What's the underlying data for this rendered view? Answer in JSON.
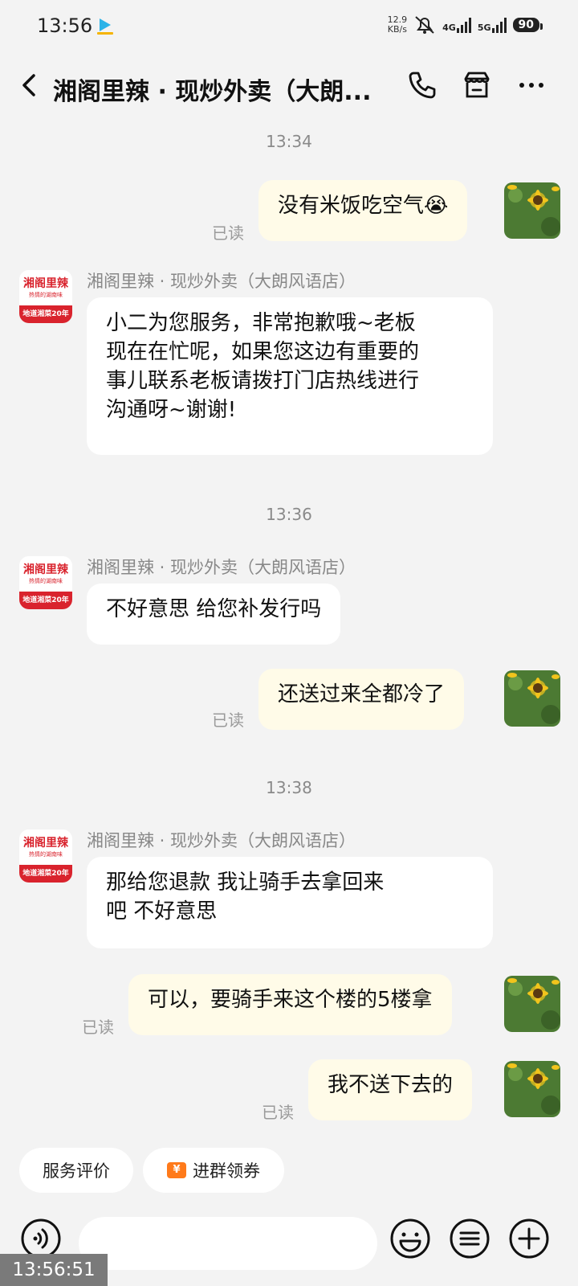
{
  "status_bar": {
    "time": "13:56",
    "net_speed_value": "12.9",
    "net_speed_unit": "KB/s",
    "signal1": "4G",
    "signal2": "5G",
    "battery": "90"
  },
  "header": {
    "title": "湘阁里辣 · 现炒外卖（大朗...",
    "icons": [
      "back-icon",
      "phone-icon",
      "shop-icon",
      "more-icon"
    ]
  },
  "messages": {
    "ts1": "13:34",
    "m1": {
      "text": "没有米饭吃空气😭",
      "status": "已读"
    },
    "shop_name": "湘阁里辣 · 现炒外卖（大朗风语店）",
    "m2": {
      "line1": "小二为您服务，非常抱歉哦~老板",
      "line2": "现在在忙呢，如果您这边有重要的",
      "line3": "事儿联系老板请拨打门店热线进行",
      "line4": "沟通呀~谢谢!"
    },
    "ts2": "13:36",
    "m3": {
      "text": "不好意思 给您补发行吗"
    },
    "m4": {
      "text": "还送过来全都冷了",
      "status": "已读"
    },
    "ts3": "13:38",
    "m5": {
      "line1": "那给您退款 我让骑手去拿回来",
      "line2": "吧 不好意思"
    },
    "m6": {
      "text": "可以，要骑手来这个楼的5楼拿",
      "status": "已读"
    },
    "m7": {
      "text": "我不送下去的",
      "status": "已读"
    }
  },
  "shop_avatar": {
    "line1": "湘阁里辣",
    "line2": "热情的湖南味",
    "line3": "地道湘菜20年"
  },
  "quick_actions": {
    "rate": "服务评价",
    "coupon": "进群领券",
    "coupon_symbol": "¥"
  },
  "input": {
    "placeholder": ""
  },
  "overlay": {
    "clock": "13:56:51"
  },
  "colors": {
    "background": "#f3f3f3",
    "incoming_bubble": "#ffffff",
    "outgoing_bubble": "#fffbe8",
    "shop_red": "#d9232d"
  }
}
